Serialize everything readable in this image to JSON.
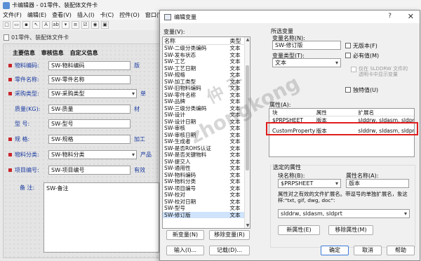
{
  "editor": {
    "title": "卡编辑器 - 01零件、装配体文件卡",
    "menu": [
      "文件(F)",
      "编辑(E)",
      "查看(V)",
      "插入(I)",
      "卡(C)",
      "控件(O)",
      "窗口(W)"
    ],
    "tab": "01零件、装配体文件卡",
    "heading": [
      "主要信息",
      "审核信息",
      "自定义信息"
    ],
    "rows": [
      {
        "label": "物料编码:",
        "value": "SW-物料编码",
        "side": "版",
        "select": false,
        "bullet": true
      },
      {
        "label": "零件名称:",
        "value": "SW-零件名称",
        "side": "",
        "select": false,
        "bullet": true
      },
      {
        "label": "采购类型:",
        "value": "SW-采购类型",
        "side": "单",
        "select": true,
        "bullet": true
      },
      {
        "label": "质量(KG):",
        "value": "SW-质量",
        "side": "材",
        "select": false,
        "bullet": false
      },
      {
        "label": "型    号:",
        "value": "SW-型号",
        "side": "",
        "select": false,
        "bullet": false
      },
      {
        "label": "规    格:",
        "value": "SW-规格",
        "side": "加工",
        "select": false,
        "bullet": true
      },
      {
        "label": "物料分类:",
        "value": "SW-物料分类",
        "side": "产品",
        "select": true,
        "bullet": true
      },
      {
        "label": "项目编号:",
        "value": "SW-项目编号",
        "side": "有效",
        "select": false,
        "bullet": true
      }
    ],
    "note_label": "备    注:",
    "note_value": "SW-备注"
  },
  "dialog": {
    "title": "编辑变量",
    "help_icon": "?",
    "close_icon": "✕",
    "variables_label": "变量(V):",
    "list_header": {
      "name": "名称",
      "type": "类型"
    },
    "variables": [
      {
        "name": "SW-二级分类编码",
        "type": "文本"
      },
      {
        "name": "SW-发布状态",
        "type": "文本"
      },
      {
        "name": "SW-工艺",
        "type": "文本"
      },
      {
        "name": "SW-工艺日期",
        "type": "文本"
      },
      {
        "name": "SW-规格",
        "type": "文本"
      },
      {
        "name": "SW-加工类型",
        "type": "文本"
      },
      {
        "name": "SW-旧物料编码",
        "type": "文本"
      },
      {
        "name": "SW-零件名称",
        "type": "文本"
      },
      {
        "name": "SW-品牌",
        "type": "文本"
      },
      {
        "name": "SW-三级分类编码",
        "type": "文本"
      },
      {
        "name": "SW-设计",
        "type": "文本"
      },
      {
        "name": "SW-设计日期",
        "type": "文本"
      },
      {
        "name": "SW-审核",
        "type": "文本"
      },
      {
        "name": "SW-审核日期",
        "type": "文本"
      },
      {
        "name": "SW-生成者",
        "type": "文本"
      },
      {
        "name": "SW-是否ROHS认证",
        "type": "文本"
      },
      {
        "name": "SW-是否关键物料",
        "type": "文本"
      },
      {
        "name": "SW-提交人",
        "type": "文本"
      },
      {
        "name": "SW-通用性",
        "type": "文本"
      },
      {
        "name": "SW-物料编码",
        "type": "文本"
      },
      {
        "name": "SW-物料分类",
        "type": "文本"
      },
      {
        "name": "SW-项目编号",
        "type": "文本"
      },
      {
        "name": "SW-校对",
        "type": "文本"
      },
      {
        "name": "SW-校对日期",
        "type": "文本"
      },
      {
        "name": "SW-型号",
        "type": "文本"
      },
      {
        "name": "SW-修订版",
        "type": "文本"
      }
    ],
    "selected_variable_index": 25,
    "new_var_btn": "新变量(N)",
    "remove_var_btn": "移除变量(R)",
    "import_btn": "输入(I)...",
    "record_btn": "记载(D)...",
    "selected_var_group": "所选变量",
    "var_name_label": "变量名称(N):",
    "var_name_value": "SW-修订版",
    "var_type_label": "变量类型(T):",
    "var_type_value": "文本",
    "no_version_chk": "无版本(F)",
    "required_chk": "必有值(M)",
    "sldrw_only_chk": "仅在 SLDDRW 文件的\n透明卡中显示变量",
    "exclusive_chk": "独特值(U)",
    "attributes_label": "属性(A):",
    "attr_header": {
      "block": "块",
      "attr": "属性",
      "ext": "扩展名"
    },
    "attributes": [
      {
        "block": "$PRPSHEET",
        "attr": "版本",
        "ext": "slddrw, sldasm, sldprt"
      },
      {
        "block": "CustomProperty",
        "attr": "版本",
        "ext": "slddrw, sldasm, sldprt"
      }
    ],
    "selected_attr_group": "选定的属性",
    "block_name_label": "块名称(B):",
    "block_name_value": "$PRPSHEET",
    "attr_name_label": "属性名称(A):",
    "attr_name_value": "版本",
    "ext_desc": "属性对之有效的文件扩展名。带逗号的单独扩展名，象这样:\"txt, gif, dwg, doc\":",
    "ext_value": "slddrw, sldasm, sldprt",
    "new_attr_btn": "新属性(E)",
    "remove_attr_btn": "移除属性(M)",
    "ok_btn": "确定",
    "cancel_btn": "取消",
    "help_btn": "帮助"
  },
  "watermark": {
    "line1": "仲 于",
    "line2": "zhongkong"
  },
  "colors": {
    "highlight": "#e11d1d",
    "label_blue": "#1a3aa0",
    "required_red": "#c8262b"
  }
}
